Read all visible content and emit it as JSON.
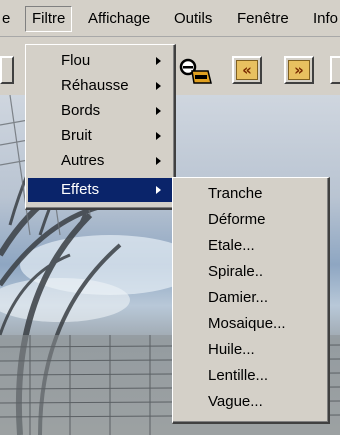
{
  "menubar": {
    "items": [
      {
        "label": "e"
      },
      {
        "label": "Filtre"
      },
      {
        "label": "Affichage"
      },
      {
        "label": "Outils"
      },
      {
        "label": "Fenêtre"
      },
      {
        "label": "Info"
      }
    ]
  },
  "toolbar": {
    "rewind_label": "«",
    "forward_label": "»"
  },
  "filtre_menu": {
    "items": [
      {
        "label": "Flou",
        "has_submenu": true
      },
      {
        "label": "Réhausse",
        "has_submenu": true
      },
      {
        "label": "Bords",
        "has_submenu": true
      },
      {
        "label": "Bruit",
        "has_submenu": true
      },
      {
        "label": "Autres",
        "has_submenu": true
      },
      {
        "label": "Effets",
        "has_submenu": true,
        "selected": true
      }
    ]
  },
  "effets_submenu": {
    "items": [
      {
        "label": "Tranche"
      },
      {
        "label": "Déforme"
      },
      {
        "label": "Etale..."
      },
      {
        "label": "Spirale.."
      },
      {
        "label": "Damier..."
      },
      {
        "label": "Mosaique..."
      },
      {
        "label": "Huile..."
      },
      {
        "label": "Lentille..."
      },
      {
        "label": "Vague..."
      }
    ]
  },
  "colors": {
    "menu_bg": "#d4d0c8",
    "highlight": "#0a246a",
    "highlight_text": "#ffffff"
  }
}
